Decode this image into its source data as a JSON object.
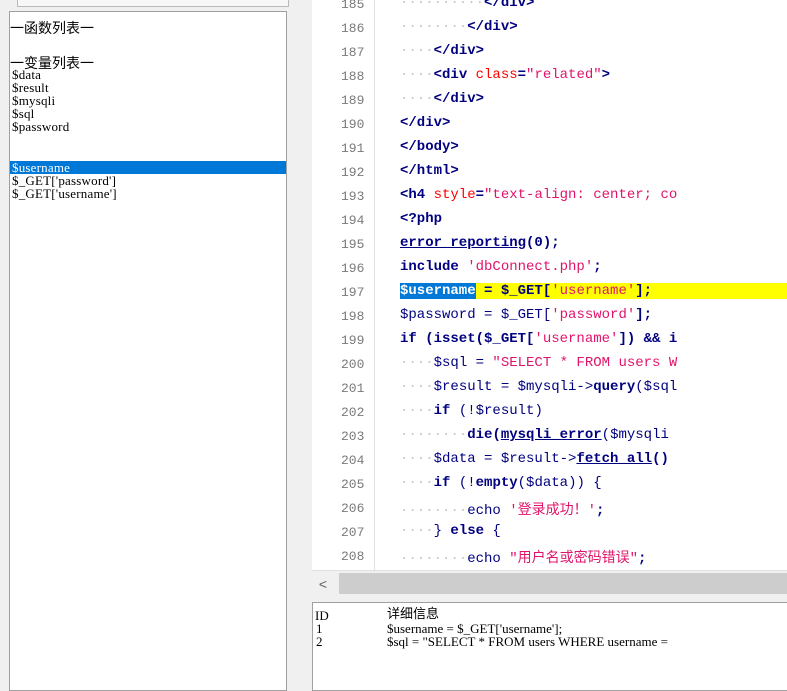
{
  "left_panel": {
    "functions_header": "一函数列表一",
    "variables_header": "一变量列表一",
    "variables": [
      "$data",
      "$result",
      "$mysqli",
      "$sql",
      "$password",
      "$username",
      "$_GET['password']",
      "$_GET['username']"
    ],
    "selected_variable": "$username"
  },
  "editor": {
    "line_numbers": [
      "185",
      "186",
      "187",
      "188",
      "189",
      "190",
      "191",
      "192",
      "193",
      "194",
      "195",
      "196",
      "197",
      "198",
      "199",
      "200",
      "201",
      "202",
      "203",
      "204",
      "205",
      "206",
      "207",
      "208"
    ],
    "lines": {
      "l185": "</div>",
      "l186": "</div>",
      "l187": "</div>",
      "l188_a": "<div ",
      "l188_b": "class",
      "l188_c": "=",
      "l188_d": "\"related\"",
      "l188_e": ">",
      "l189": "</div>",
      "l190": "</div>",
      "l191": "</body>",
      "l192": "</html>",
      "l193_a": "<h4 ",
      "l193_b": "style",
      "l193_c": "=",
      "l193_d": "\"text-align: center; co",
      "l194": "<?php",
      "l195_a": "error_reporting",
      "l195_b": "(0);",
      "l196_a": "include ",
      "l196_b": "'dbConnect.php'",
      "l196_c": ";",
      "l197_a": "$username",
      "l197_b": " = $_GET[",
      "l197_c": "'username'",
      "l197_d": "];",
      "l198_a": "$password = $_GET[",
      "l198_b": "'password'",
      "l198_c": "];",
      "l199_a": "if (isset($_GET[",
      "l199_b": "'username'",
      "l199_c": "]) && i",
      "l200_a": "$sql = ",
      "l200_b": "\"SELECT * FROM users W",
      "l201_a": "$result = $mysqli->",
      "l201_b": "query",
      "l201_c": "($sql",
      "l202_a": "if ",
      "l202_b": "(!$result)",
      "l203_a": "die",
      "l203_b": "(",
      "l203_c": "mysqli_error",
      "l203_d": "($mysqli",
      "l204_a": "$data = $result->",
      "l204_b": "fetch_all",
      "l204_c": "()",
      "l205_a": "if ",
      "l205_b": "(!",
      "l205_c": "empty",
      "l205_d": "($data)) {",
      "l206_a": "echo ",
      "l206_b": "'登录成功！'",
      "l206_c": ";",
      "l207_a": "} ",
      "l207_b": "else",
      "l207_c": " {",
      "l208_a": "echo ",
      "l208_b": "\"用户名或密码错误\"",
      "l208_c": ";"
    }
  },
  "scrollbar": {
    "left_arrow": "<"
  },
  "detail": {
    "col_id": "ID",
    "col_info": "详细信息",
    "rows": [
      {
        "id": "1",
        "info": "$username = $_GET['username'];"
      },
      {
        "id": "2",
        "info": "$sql = \"SELECT * FROM users WHERE username ="
      }
    ]
  },
  "colors": {
    "selection": "#0078d7",
    "highlight": "#ffff00",
    "string": "#e0146a",
    "keyword": "#000080",
    "attribute": "#ff0000"
  }
}
